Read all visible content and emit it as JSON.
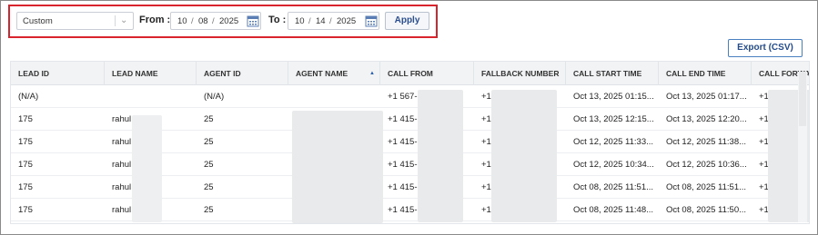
{
  "filter": {
    "range_select": "Custom",
    "from_label": "From :",
    "from": {
      "month": "10",
      "day": "08",
      "year": "2025"
    },
    "to_label": "To :",
    "to": {
      "month": "10",
      "day": "14",
      "year": "2025"
    },
    "apply_label": "Apply",
    "date_sep": "/"
  },
  "export_label": "Export (CSV)",
  "table": {
    "columns": [
      "LEAD ID",
      "LEAD NAME",
      "AGENT ID",
      "AGENT NAME",
      "CALL FROM",
      "FALLBACK NUMBER",
      "CALL START TIME",
      "CALL END TIME",
      "CALL FORWA"
    ],
    "sorted_column": "AGENT NAME",
    "rows": [
      {
        "lead_id": "(N/A)",
        "lead_name": "",
        "agent_id": "(N/A)",
        "agent_name": "",
        "call_from": "+1 567-",
        "fallback": "+1",
        "start": "Oct 13, 2025 01:15...",
        "end": "Oct 13, 2025 01:17...",
        "forward": "+1"
      },
      {
        "lead_id": "175",
        "lead_name": "rahul",
        "agent_id": "25",
        "agent_name": "",
        "call_from": "+1 415-",
        "fallback": "+1",
        "start": "Oct 13, 2025 12:15...",
        "end": "Oct 13, 2025 12:20...",
        "forward": "+1"
      },
      {
        "lead_id": "175",
        "lead_name": "rahul",
        "agent_id": "25",
        "agent_name": "",
        "call_from": "+1 415-",
        "fallback": "+1",
        "start": "Oct 12, 2025 11:33...",
        "end": "Oct 12, 2025 11:38...",
        "forward": "+1"
      },
      {
        "lead_id": "175",
        "lead_name": "rahul",
        "agent_id": "25",
        "agent_name": "",
        "call_from": "+1 415-",
        "fallback": "+1",
        "start": "Oct 12, 2025 10:34...",
        "end": "Oct 12, 2025 10:36...",
        "forward": "+1"
      },
      {
        "lead_id": "175",
        "lead_name": "rahul",
        "agent_id": "25",
        "agent_name": "",
        "call_from": "+1 415-",
        "fallback": "+1",
        "start": "Oct 08, 2025 11:51...",
        "end": "Oct 08, 2025 11:51...",
        "forward": "+1"
      },
      {
        "lead_id": "175",
        "lead_name": "rahul",
        "agent_id": "25",
        "agent_name": "",
        "call_from": "+1 415-",
        "fallback": "+1",
        "start": "Oct 08, 2025 11:48...",
        "end": "Oct 08, 2025 11:50...",
        "forward": "+1"
      }
    ]
  },
  "colors": {
    "highlight_border": "#d9232d",
    "accent": "#2d5fa7"
  },
  "icons": {
    "select_arrow": "chevron-down-icon",
    "date_picker": "calendar-icon",
    "sort": "sort-ascending-icon"
  }
}
